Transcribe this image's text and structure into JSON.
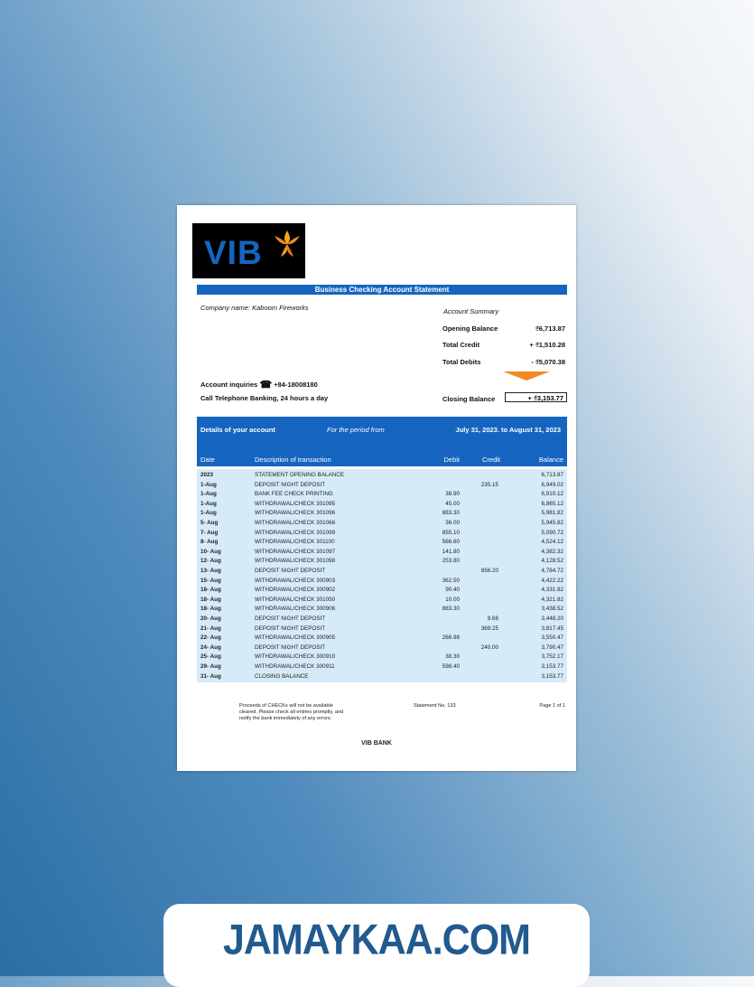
{
  "logo": {
    "text": "VIB"
  },
  "statement_title": "Business Checking Account Statement",
  "company": "Company name: Kaboom Fireworks",
  "summary": {
    "title": "Account Summary",
    "opening_label": "Opening Balance",
    "opening_value": "₫6,713.87",
    "credit_label": "Total Credit",
    "credit_value": "+ ₫1,510.28",
    "debit_label": "Total Debits",
    "debit_value": "- ₫5,070.38",
    "closing_label": "Closing Balance",
    "closing_value": "+ ₫3,153.77",
    "arrow_color": "#f08a24"
  },
  "contact": {
    "inquiries_label": "Account inquiries",
    "phone_icon": "telephone-icon",
    "phone": "+84-18008180",
    "telephone_banking": "Call Telephone Banking, 24 hours a day"
  },
  "details": {
    "heading": "Details of your account",
    "period_label": "For the period from",
    "period": "July 31, 2023. to August 31, 2023",
    "columns": [
      "Date",
      "Description of transaction",
      "Debit",
      "Credit",
      "Balance"
    ]
  },
  "transactions": [
    {
      "date": "2023",
      "desc": "STATEMENT OPENING BALANCE",
      "debit": "",
      "credit": "",
      "balance": "6,713.87"
    },
    {
      "date": "1-Aug",
      "desc": "DEPOSIT NIGHT DEPOSIT",
      "debit": "",
      "credit": "235.15",
      "balance": "6,949.02"
    },
    {
      "date": "1-Aug",
      "desc": "BANK FEE CHECK PRINTING",
      "debit": "38.90",
      "credit": "",
      "balance": "6,910.12"
    },
    {
      "date": "1-Aug",
      "desc": "WITHDRAWAL/CHECK 301095",
      "debit": "45.00",
      "credit": "",
      "balance": "6,865.12"
    },
    {
      "date": "1-Aug",
      "desc": "WITHDRAWAL/CHECK 301096",
      "debit": "883.30",
      "credit": "",
      "balance": "5,981.82"
    },
    {
      "date": "5- Aug",
      "desc": "WITHDRAWAL/CHECK 301066",
      "debit": "36.00",
      "credit": "",
      "balance": "5,945.82"
    },
    {
      "date": "7- Aug",
      "desc": "WITHDRAWAL/CHECK 301099",
      "debit": "855.10",
      "credit": "",
      "balance": "5,090.72"
    },
    {
      "date": "8- Aug",
      "desc": "WITHDRAWAL/CHECK 301100",
      "debit": "566.60",
      "credit": "",
      "balance": "4,524.12"
    },
    {
      "date": "10- Aug",
      "desc": "WITHDRAWAL/CHECK 301097",
      "debit": "141.80",
      "credit": "",
      "balance": "4,382.32"
    },
    {
      "date": "12- Aug",
      "desc": "WITHDRAWAL/CHECK 301098",
      "debit": "253.80",
      "credit": "",
      "balance": "4,128.52"
    },
    {
      "date": "13- Aug",
      "desc": "DEPOSIT NIGHT DEPOSIT",
      "debit": "",
      "credit": "656.20",
      "balance": "4,784.72"
    },
    {
      "date": "15- Aug",
      "desc": "WITHDRAWAL/CHECK 300903",
      "debit": "362.50",
      "credit": "",
      "balance": "4,422.22"
    },
    {
      "date": "18- Aug",
      "desc": "WITHDRAWAL/CHECK 300902",
      "debit": "90.40",
      "credit": "",
      "balance": "4,331.82"
    },
    {
      "date": "18- Aug",
      "desc": "WITHDRAWAL/CHECK 301050",
      "debit": "10.00",
      "credit": "",
      "balance": "4,321.82"
    },
    {
      "date": "18- Aug",
      "desc": "WITHDRAWAL/CHECK 300906",
      "debit": "883.30",
      "credit": "",
      "balance": "3,438.52"
    },
    {
      "date": "20- Aug",
      "desc": "DEPOSIT NIGHT DEPOSIT",
      "debit": "",
      "credit": "9.68",
      "balance": "3,448.20"
    },
    {
      "date": "21- Aug",
      "desc": "DEPOSIT NIGHT DEPOSIT",
      "debit": "",
      "credit": "369.25",
      "balance": "3,817.45"
    },
    {
      "date": "22- Aug",
      "desc": "WITHDRAWAL/CHECK 300905",
      "debit": "266.98",
      "credit": "",
      "balance": "3,550.47"
    },
    {
      "date": "24- Aug",
      "desc": "DEPOSIT NIGHT DEPOSIT",
      "debit": "",
      "credit": "240.00",
      "balance": "3,790.47"
    },
    {
      "date": "25- Aug",
      "desc": "WITHDRAWAL/CHECK 300910",
      "debit": "38.30",
      "credit": "",
      "balance": "3,752.17"
    },
    {
      "date": "29- Aug",
      "desc": "WITHDRAWAL/CHECK 300911",
      "debit": "598.40",
      "credit": "",
      "balance": "3,153.77"
    },
    {
      "date": "31- Aug",
      "desc": "CLOSING BALANCE",
      "debit": "",
      "credit": "",
      "balance": "3,153.77"
    }
  ],
  "footer": {
    "note_line1": "Proceeds of CHECKs will not be available",
    "note_line2": "cleared. Please check all entries promptly, and",
    "note_line3": "notify the bank immediately of any errors.",
    "statement_no": "Statement No. 133",
    "page": "Page 1 of 1",
    "bank": "VIB BANK"
  },
  "banner": {
    "text": "JAMAYKAA.COM"
  },
  "colors": {
    "primary_blue": "#1565c0",
    "table_bg": "#d6ebf8",
    "accent_orange": "#f08a24"
  }
}
